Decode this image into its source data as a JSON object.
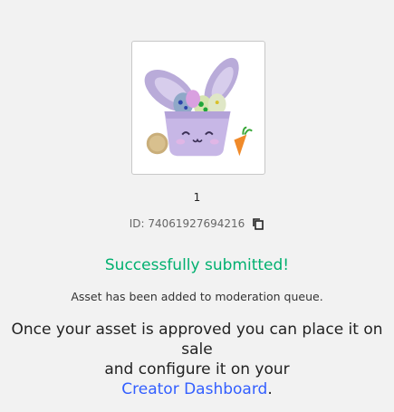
{
  "asset": {
    "name": "1",
    "id_label": "ID: 74061927694216",
    "thumbnail_alt": "bunny basket accessory",
    "copy_icon": "copy-icon"
  },
  "status": {
    "success_text": "Successfully submitted!",
    "queue_text": "Asset has been added to moderation queue.",
    "message_line1": "Once your asset is approved you can place it on sale",
    "message_line2": "and configure it on your",
    "dashboard_link": "Creator Dashboard",
    "message_end": "."
  },
  "colors": {
    "success": "#00b06f",
    "link": "#335fff",
    "background": "#f2f2f2"
  }
}
